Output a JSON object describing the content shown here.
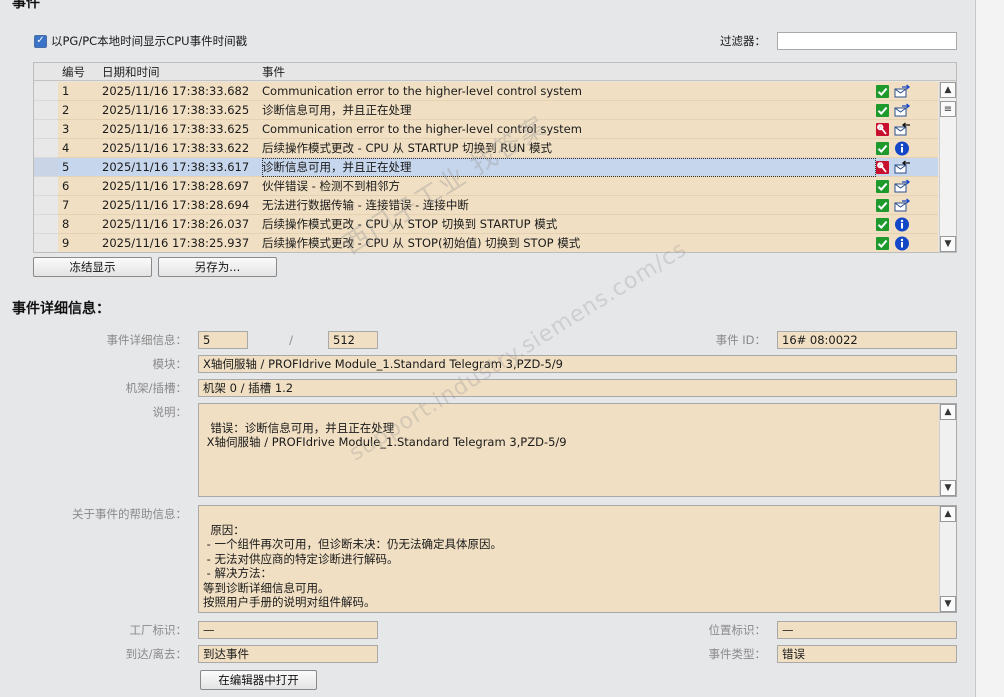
{
  "header": {
    "title": "事件"
  },
  "options": {
    "checkbox_label": "以PG/PC本地时间显示CPU事件时间戳",
    "checkbox_checked": true,
    "filter_label": "过滤器：",
    "filter_value": ""
  },
  "table": {
    "columns": [
      "编号",
      "日期和时间",
      "事件"
    ],
    "rows": [
      {
        "num": "1",
        "datetime": "2025/11/16 17:38:33.682",
        "event": "Communication error to the higher-level control system",
        "icon1": "green-check-icon",
        "icon2": "outgoing-event-icon"
      },
      {
        "num": "2",
        "datetime": "2025/11/16 17:38:33.625",
        "event": "诊断信息可用，并且正在处理",
        "icon1": "green-check-icon",
        "icon2": "outgoing-event-icon"
      },
      {
        "num": "3",
        "datetime": "2025/11/16 17:38:33.625",
        "event": "Communication error to the higher-level control system",
        "icon1": "red-maintenance-icon",
        "icon2": "incoming-event-icon"
      },
      {
        "num": "4",
        "datetime": "2025/11/16 17:38:33.622",
        "event": "后续操作模式更改 - CPU 从 STARTUP 切换到 RUN 模式",
        "icon1": "green-check-icon",
        "icon2": "info-icon"
      },
      {
        "num": "5",
        "datetime": "2025/11/16 17:38:33.617",
        "event": "诊断信息可用，并且正在处理",
        "icon1": "red-maintenance-icon",
        "icon2": "incoming-event-icon",
        "selected": true
      },
      {
        "num": "6",
        "datetime": "2025/11/16 17:38:28.697",
        "event": "伙伴错误 - 检测不到相邻方",
        "icon1": "green-check-icon",
        "icon2": "outgoing-event-icon"
      },
      {
        "num": "7",
        "datetime": "2025/11/16 17:38:28.694",
        "event": "无法进行数据传输 - 连接错误 - 连接中断",
        "icon1": "green-check-icon",
        "icon2": "outgoing-event-icon"
      },
      {
        "num": "8",
        "datetime": "2025/11/16 17:38:26.037",
        "event": "后续操作模式更改 - CPU 从 STOP 切换到 STARTUP 模式",
        "icon1": "green-check-icon",
        "icon2": "info-icon"
      },
      {
        "num": "9",
        "datetime": "2025/11/16 17:38:25.937",
        "event": "后续操作模式更改 - CPU 从 STOP(初始值) 切换到 STOP 模式",
        "icon1": "green-check-icon",
        "icon2": "info-icon"
      }
    ]
  },
  "buttons": {
    "freeze": "冻结显示",
    "save_as": "另存为...",
    "open_editor": "在编辑器中打开"
  },
  "details": {
    "title": "事件详细信息：",
    "info_label": "事件详细信息：",
    "info_current": "5",
    "info_separator": "/",
    "info_total": "512",
    "event_id_label": "事件 ID：",
    "event_id": "16# 08:0022",
    "module_label": "模块：",
    "module": "X轴伺服轴 / PROFIdrive Module_1.Standard Telegram 3,PZD-5/9",
    "rack_label": "机架/插槽：",
    "rack": "机架 0 / 插槽 1.2",
    "desc_label": "说明：",
    "desc": "错误：诊断信息可用，并且正在处理\n X轴伺服轴 / PROFIdrive Module_1.Standard Telegram 3,PZD-5/9",
    "help_label": "关于事件的帮助信息：",
    "help": "原因：\n - 一个组件再次可用，但诊断未决：仍无法确定具体原因。\n - 无法对供应商的特定诊断进行解码。\n - 解决方法：\n等到诊断详细信息可用。\n按照用户手册的说明对组件解码。",
    "plant_label": "工厂标识：",
    "plant": "—",
    "location_label": "位置标识：",
    "location": "—",
    "arrive_label": "到达/离去：",
    "arrive": "到达事件",
    "type_label": "事件类型：",
    "type": "错误"
  },
  "watermark": {
    "line1": "西门子工业  找答案",
    "line2": "support.industry.siemens.com/cs"
  },
  "colors": {
    "field_bg": "#f0dfc3",
    "selected_row": "#c6d6ec",
    "ok_green": "#1e9a2c",
    "error_red": "#c8102e",
    "info_blue": "#1447c8"
  }
}
